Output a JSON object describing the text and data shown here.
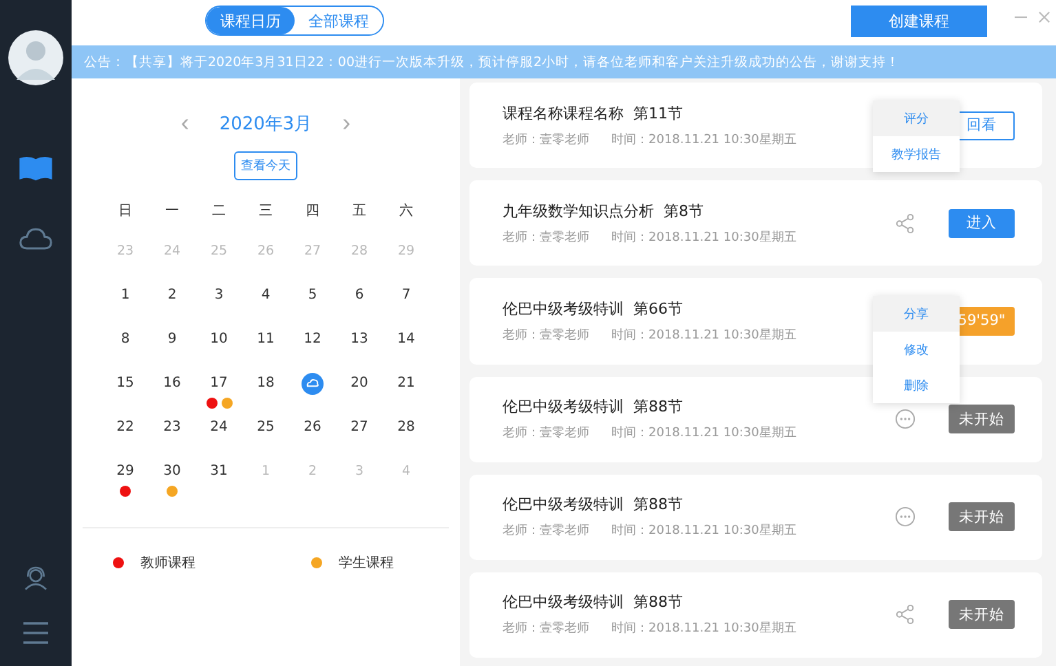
{
  "sidebar": {
    "items": [
      {
        "kind": "book",
        "selected": true
      },
      {
        "kind": "cloud",
        "selected": false
      }
    ],
    "bottom": [
      {
        "kind": "support"
      },
      {
        "kind": "menu"
      }
    ]
  },
  "header": {
    "tabs": [
      {
        "label": "课程日历",
        "selected": true
      },
      {
        "label": "全部课程",
        "selected": false
      }
    ],
    "create_button": "创建课程"
  },
  "notice": "公告：【共享】将于2020年3月31日22：00进行一次版本升级，预计停服2小时，请各位老师和客户关注升级成功的公告，谢谢支持！",
  "calendar": {
    "month": "2020年3月",
    "prev": "‹",
    "next": "›",
    "today_button": "查看今天",
    "weekdays": [
      "日",
      "一",
      "二",
      "三",
      "四",
      "五",
      "六"
    ],
    "days": [
      {
        "day": "23",
        "muted": true
      },
      {
        "day": "24",
        "muted": true
      },
      {
        "day": "25",
        "muted": true
      },
      {
        "day": "26",
        "muted": true
      },
      {
        "day": "27",
        "muted": true
      },
      {
        "day": "28",
        "muted": true
      },
      {
        "day": "29",
        "muted": true
      },
      {
        "day": "1",
        "muted": false
      },
      {
        "day": "2",
        "muted": false
      },
      {
        "day": "3",
        "muted": false
      },
      {
        "day": "4",
        "muted": false
      },
      {
        "day": "5",
        "muted": false
      },
      {
        "day": "6",
        "muted": false
      },
      {
        "day": "7",
        "muted": false
      },
      {
        "day": "8",
        "muted": false
      },
      {
        "day": "9",
        "muted": false
      },
      {
        "day": "10",
        "muted": false
      },
      {
        "day": "11",
        "muted": false
      },
      {
        "day": "12",
        "muted": false
      },
      {
        "day": "13",
        "muted": false
      },
      {
        "day": "14",
        "muted": false
      },
      {
        "day": "15",
        "muted": false
      },
      {
        "day": "16",
        "muted": false
      },
      {
        "day": "17",
        "muted": false,
        "dots": [
          {
            "color": "#ee1111"
          },
          {
            "color": "#f5a623"
          }
        ]
      },
      {
        "day": "18",
        "muted": false
      },
      {
        "selected": true
      },
      {
        "day": "20",
        "muted": false
      },
      {
        "day": "21",
        "muted": false
      },
      {
        "day": "22",
        "muted": false
      },
      {
        "day": "23",
        "muted": false
      },
      {
        "day": "24",
        "muted": false
      },
      {
        "day": "25",
        "muted": false
      },
      {
        "day": "26",
        "muted": false
      },
      {
        "day": "27",
        "muted": false
      },
      {
        "day": "28",
        "muted": false
      },
      {
        "day": "29",
        "muted": false,
        "dots": [
          {
            "color": "#ee1111"
          }
        ]
      },
      {
        "day": "30",
        "muted": false,
        "dots": [
          {
            "color": "#f5a623"
          }
        ]
      },
      {
        "day": "31",
        "muted": false
      },
      {
        "day": "1",
        "muted": true
      },
      {
        "day": "2",
        "muted": true
      },
      {
        "day": "3",
        "muted": true
      },
      {
        "day": "4",
        "muted": true
      }
    ],
    "legend": [
      {
        "label": "教师课程",
        "color": "#ee1111"
      },
      {
        "label": "学生课程",
        "color": "#f5a623"
      }
    ]
  },
  "courses": [
    {
      "title": "课程名称课程名称  第11节",
      "teacher": "老师：壹零老师",
      "time": "时间：2018.11.21 10:30星期五",
      "action": {
        "kind": "outline",
        "label": "回看"
      },
      "menu": [
        {
          "label": "评分",
          "selected": true
        },
        {
          "label": "教学报告",
          "selected": false
        }
      ]
    },
    {
      "title": "九年级数学知识点分析  第8节",
      "teacher": "老师：壹零老师",
      "time": "时间：2018.11.21 10:30星期五",
      "tool": {
        "kind": "share"
      },
      "action": {
        "kind": "primary",
        "label": "进入"
      }
    },
    {
      "title": "伦巴中级考级特训  第66节",
      "teacher": "老师：壹零老师",
      "time": "时间：2018.11.21 10:30星期五",
      "action": {
        "kind": "countdown",
        "label": "59'59\""
      },
      "menu": [
        {
          "label": "分享",
          "selected": true
        },
        {
          "label": "修改",
          "selected": false
        },
        {
          "label": "删除",
          "selected": false
        }
      ]
    },
    {
      "title": "伦巴中级考级特训  第88节",
      "teacher": "老师：壹零老师",
      "time": "时间：2018.11.21 10:30星期五",
      "tool": {
        "kind": "more"
      },
      "action": {
        "kind": "pending",
        "label": "未开始"
      }
    },
    {
      "title": "伦巴中级考级特训  第88节",
      "teacher": "老师：壹零老师",
      "time": "时间：2018.11.21 10:30星期五",
      "tool": {
        "kind": "more"
      },
      "action": {
        "kind": "pending",
        "label": "未开始"
      }
    },
    {
      "title": "伦巴中级考级特训  第88节",
      "teacher": "老师：壹零老师",
      "time": "时间：2018.11.21 10:30星期五",
      "tool": {
        "kind": "share"
      },
      "action": {
        "kind": "pending",
        "label": "未开始"
      }
    }
  ]
}
